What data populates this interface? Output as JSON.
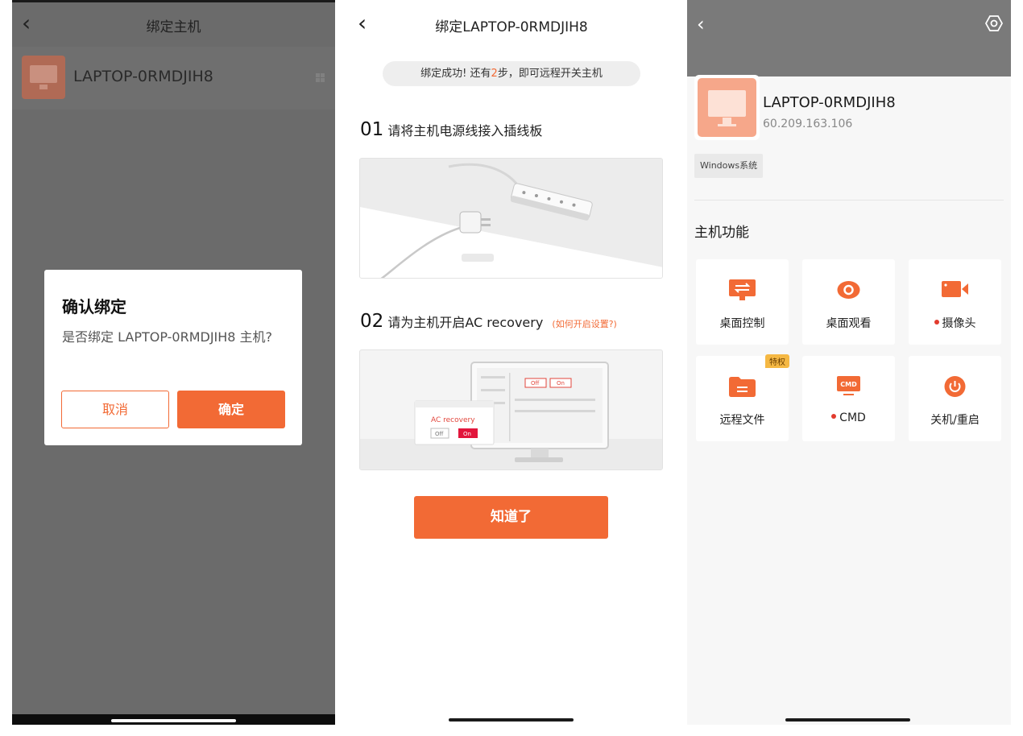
{
  "screen1": {
    "title": "绑定主机",
    "host_name": "LAPTOP-0RMDJIH8",
    "dialog": {
      "title": "确认绑定",
      "message": "是否绑定 LAPTOP-0RMDJIH8 主机?",
      "cancel": "取消",
      "confirm": "确定"
    }
  },
  "screen2": {
    "title": "绑定LAPTOP-0RMDJIH8",
    "banner_prefix": "绑定成功! 还有",
    "banner_num": "2",
    "banner_suffix": "步，即可远程开关主机",
    "step1": {
      "num": "01",
      "text": "请将主机电源线接入插线板"
    },
    "step2": {
      "num": "02",
      "text": "请为主机开启AC recovery",
      "link": "(如何开启设置?)"
    },
    "illustration": {
      "ac_label": "AC recovery",
      "off": "Off",
      "on": "On"
    },
    "button": "知道了"
  },
  "screen3": {
    "host_name": "LAPTOP-0RMDJIH8",
    "ip": "60.209.163.106",
    "os_tag": "Windows系统",
    "section_title": "主机功能",
    "features": [
      {
        "label": "桌面控制",
        "icon": "desktop-control-icon",
        "dot": false,
        "badge": ""
      },
      {
        "label": "桌面观看",
        "icon": "eye-icon",
        "dot": false,
        "badge": ""
      },
      {
        "label": "摄像头",
        "icon": "camera-icon",
        "dot": true,
        "badge": ""
      },
      {
        "label": "远程文件",
        "icon": "folder-icon",
        "dot": false,
        "badge": "特权"
      },
      {
        "label": "CMD",
        "icon": "cmd-icon",
        "dot": true,
        "badge": ""
      },
      {
        "label": "关机/重启",
        "icon": "power-icon",
        "dot": false,
        "badge": ""
      }
    ],
    "accent_color": "#f26a35"
  }
}
